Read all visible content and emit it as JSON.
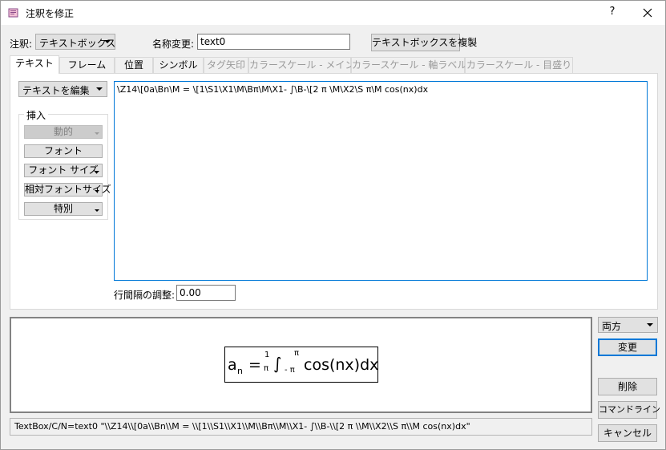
{
  "window": {
    "title": "注釈を修正",
    "help_glyph": "?"
  },
  "top": {
    "annotation_label": "注釈:",
    "annotation_type": "テキストボックス",
    "rename_label": "名称変更:",
    "name_value": "text0",
    "duplicate_button": "テキストボックスを複製"
  },
  "tabs": [
    {
      "label": "テキスト",
      "active": true,
      "disabled": false
    },
    {
      "label": "フレーム",
      "active": false,
      "disabled": false
    },
    {
      "label": "位置",
      "active": false,
      "disabled": false
    },
    {
      "label": "シンボル",
      "active": false,
      "disabled": false
    },
    {
      "label": "タグ矢印",
      "active": false,
      "disabled": true
    },
    {
      "label": "カラースケール - メイン",
      "active": false,
      "disabled": true
    },
    {
      "label": "カラースケール - 軸ラベル",
      "active": false,
      "disabled": true
    },
    {
      "label": "カラースケール - 目盛り",
      "active": false,
      "disabled": true
    }
  ],
  "text_tab": {
    "edit_menu": "テキストを編集",
    "insert_group": "挿入",
    "insert_buttons": [
      "動的",
      "フォント",
      "フォント サイズ",
      "相対フォントサイズ",
      "特別"
    ],
    "editor_text": "\\Z14\\[0a\\Bn\\M = \\[1\\S1\\X1\\M\\Bπ\\M\\X1- ∫\\B-\\[2 π \\M\\X2\\S π\\M cos(nx)dx",
    "line_spacing_label": "行間隔の調整:",
    "line_spacing_value": "0.00"
  },
  "preview": {
    "a": "a",
    "n_sub": "n",
    "equals": "=",
    "frac_num": "1",
    "frac_den": "π",
    "integral": "∫",
    "lower_limit": "- π",
    "upper_limit": "π",
    "tail": "cos(nx)dx"
  },
  "right_panel": {
    "mode": "両方",
    "change_button": "変更",
    "delete_button": "削除",
    "command_line_button": "コマンドライン",
    "cancel_button": "キャンセル"
  },
  "status": {
    "command": "TextBox/C/N=text0 \"\\\\Z14\\\\[0a\\\\Bn\\\\M = \\\\[1\\\\S1\\\\X1\\\\M\\\\Bπ\\\\M\\\\X1- ∫\\\\B-\\\\[2 π \\\\M\\\\X2\\\\S π\\\\M cos(nx)dx\""
  }
}
